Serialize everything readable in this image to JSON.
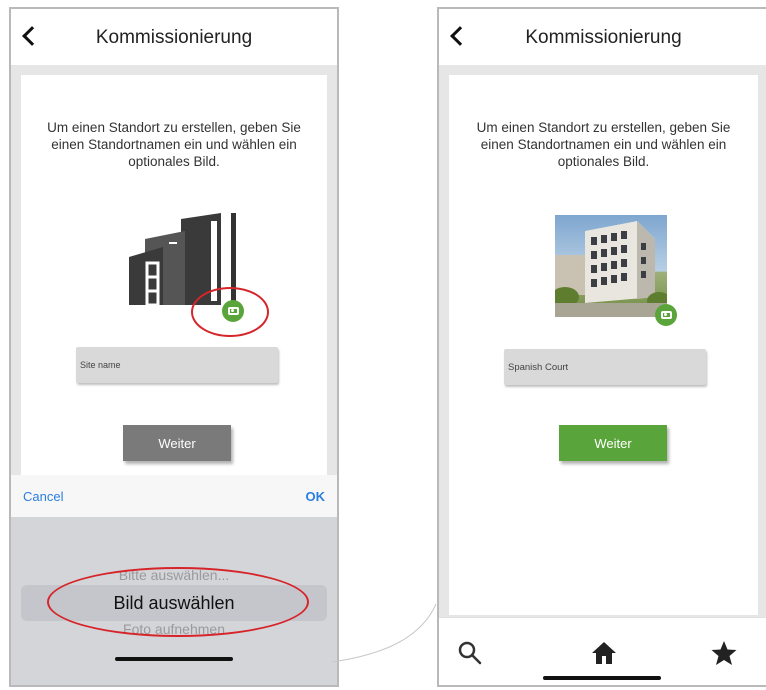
{
  "left_screen": {
    "navbar": {
      "title": "Kommissionierung"
    },
    "intro_text": "Um einen Standort zu erstellen, geben Sie einen Standortnamen ein und wählen ein optionales Bild.",
    "site_name_placeholder": "Site name",
    "continue_label": "Weiter",
    "continue_color": "#7a7a7a",
    "picker": {
      "cancel_label": "Cancel",
      "ok_label": "OK",
      "options": [
        "Bitte auswählen...",
        "Bild auswählen",
        "Foto aufnehmen"
      ],
      "selected": "Bild auswählen"
    }
  },
  "right_screen": {
    "navbar": {
      "title": "Kommissionierung"
    },
    "intro_text": "Um einen Standort zu erstellen, geben Sie einen Standortnamen ein und wählen ein optionales Bild.",
    "site_name_value": "Spanish Court",
    "continue_label": "Weiter",
    "continue_color": "#5aa53b",
    "tabs": [
      {
        "icon": "search-icon"
      },
      {
        "icon": "home-icon"
      },
      {
        "icon": "star-icon"
      }
    ]
  },
  "colors": {
    "accent_green": "#5aa53b",
    "highlight_red": "#d6252a",
    "link_blue": "#2a7ee0"
  }
}
